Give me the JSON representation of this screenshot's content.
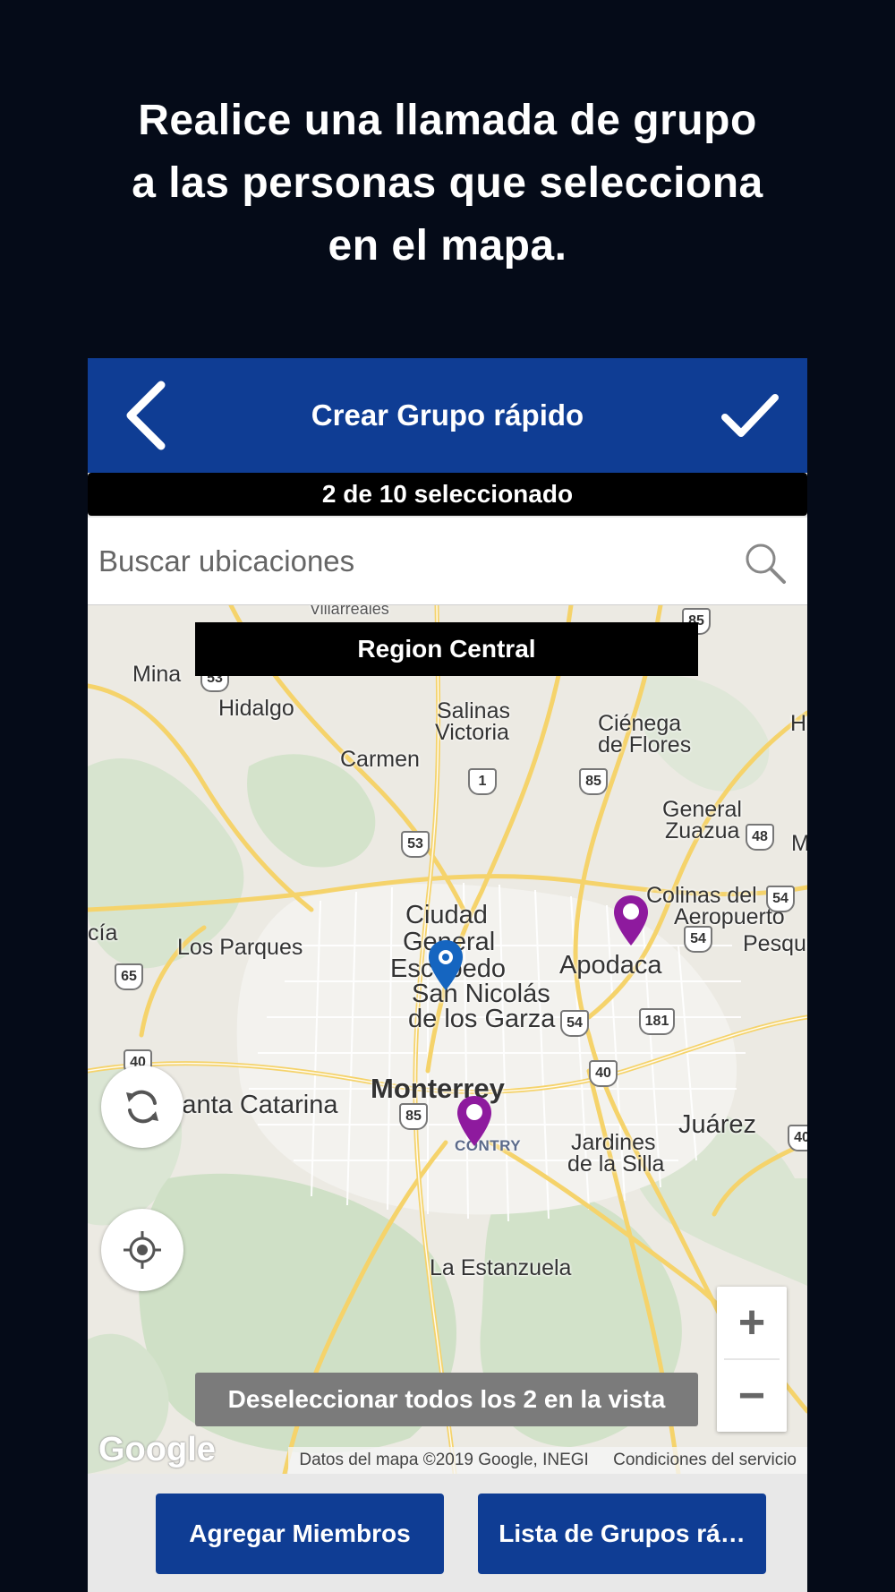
{
  "headline": {
    "line1": "Realice una llamada de grupo",
    "line2": "a las personas que selecciona",
    "line3": "en el mapa."
  },
  "appbar": {
    "title": "Crear Grupo rápido",
    "back_icon": "chevron-left-icon",
    "confirm_icon": "checkmark-icon",
    "color": "#0f3d94"
  },
  "selection": {
    "counter": "2 de 10 seleccionado"
  },
  "search": {
    "placeholder": "Buscar ubicaciones",
    "value": "",
    "icon": "search-icon"
  },
  "map": {
    "region_label": "Region Central",
    "top_edge_label": "Villarreales",
    "places": {
      "mina": "Mina",
      "hidalgo": "Hidalgo",
      "salinas": "Salinas",
      "victoria": "Victoria",
      "cienega": "Ciénega",
      "de_flores": "de Flores",
      "carmen": "Carmen",
      "general": "General",
      "zuazua": "Zuazua",
      "colinas_del": "Colinas del",
      "aeropuerto": "Aeropuerto",
      "ciudad": "Ciudad",
      "general2": "General",
      "escobedo": "Escobedo",
      "cia": "cía",
      "los_parques": "Los Parques",
      "apodaca": "Apodaca",
      "pesque": "Pesque",
      "san_nicolas": "San Nicolás",
      "de_los_garza": "de los Garza",
      "monterrey": "Monterrey",
      "santa_catarina": "Santa Catarina",
      "juarez": "Juárez",
      "contry": "CONTRY",
      "jardines": "Jardines",
      "de_la_silla": "de la Silla",
      "la_estanzuela": "La Estanzuela",
      "h_edge": "H",
      "m_edge": "M"
    },
    "shields": {
      "s85a": "85",
      "s53a": "53",
      "s1": "1",
      "s85b": "85",
      "s53b": "53",
      "s48": "48",
      "s54a": "54",
      "s54b": "54",
      "s65": "65",
      "s54c": "54",
      "s181": "181",
      "s40a": "40",
      "s40b": "40",
      "s85c": "85",
      "s40c": "40"
    },
    "markers": [
      {
        "name": "marker-blue",
        "color": "#1565c0"
      },
      {
        "name": "marker-purple-apodaca",
        "color": "#8e1a9e"
      },
      {
        "name": "marker-purple-contry",
        "color": "#8e1a9e"
      }
    ],
    "refresh_icon": "refresh-icon",
    "locate_icon": "crosshair-icon",
    "zoom_in": "+",
    "zoom_out": "−",
    "deselect_label": "Deseleccionar todos los 2 en la vista",
    "google_logo": "Google",
    "attribution_data": "Datos del mapa ©2019 Google, INEGI",
    "attribution_terms": "Condiciones del servicio"
  },
  "actions": {
    "add_members": "Agregar Miembros",
    "group_list": "Lista de Grupos rá…"
  }
}
